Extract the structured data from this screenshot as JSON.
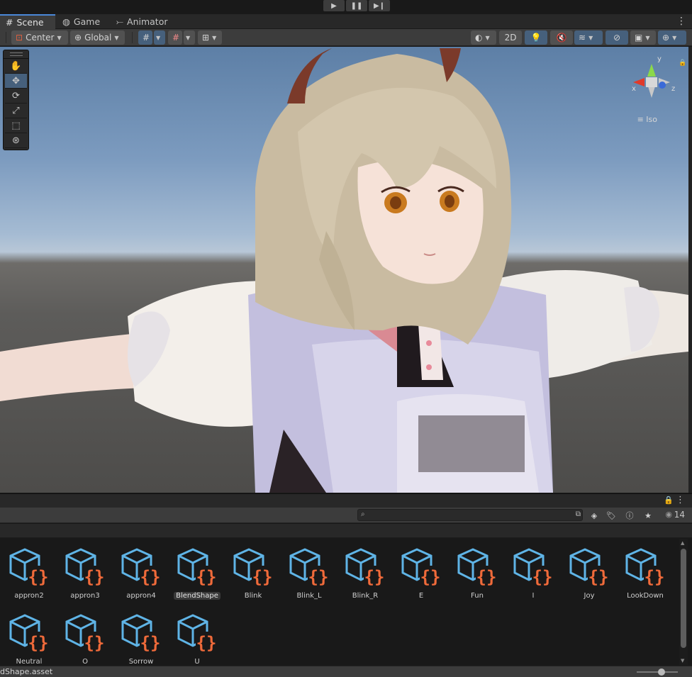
{
  "playbar": {
    "play_icon": "play-icon",
    "pause_icon": "pause-icon",
    "step_icon": "step-icon"
  },
  "tabs": [
    {
      "label": "Scene",
      "icon": "hash-grid-icon",
      "active": true
    },
    {
      "label": "Game",
      "icon": "gamepad-icon",
      "active": false
    },
    {
      "label": "Animator",
      "icon": "animator-icon",
      "active": false
    }
  ],
  "scene_toolbar": {
    "pivot_label": "Center",
    "space_label": "Global",
    "mode_2d_label": "2D"
  },
  "viewport": {
    "gizmo": {
      "x": "x",
      "y": "y",
      "z": "z"
    },
    "projection_label": "Iso"
  },
  "project": {
    "search": {
      "value": "",
      "placeholder": ""
    },
    "visibility_count": "14",
    "assets": [
      {
        "label": "appron2",
        "selected": false
      },
      {
        "label": "appron3",
        "selected": false
      },
      {
        "label": "appron4",
        "selected": false
      },
      {
        "label": "BlendShape",
        "selected": true
      },
      {
        "label": "Blink",
        "selected": false
      },
      {
        "label": "Blink_L",
        "selected": false
      },
      {
        "label": "Blink_R",
        "selected": false
      },
      {
        "label": "E",
        "selected": false
      },
      {
        "label": "Fun",
        "selected": false
      },
      {
        "label": "I",
        "selected": false
      },
      {
        "label": "Joy",
        "selected": false
      },
      {
        "label": "LookDown",
        "selected": false
      },
      {
        "label": "Neutral",
        "selected": false
      },
      {
        "label": "O",
        "selected": false
      },
      {
        "label": "Sorrow",
        "selected": false
      },
      {
        "label": "U",
        "selected": false
      }
    ],
    "status_path": "dShape.asset"
  },
  "colors": {
    "accent": "#46607c",
    "asset_cube": "#5fb4e6",
    "asset_braces": "#ef6a3a"
  }
}
